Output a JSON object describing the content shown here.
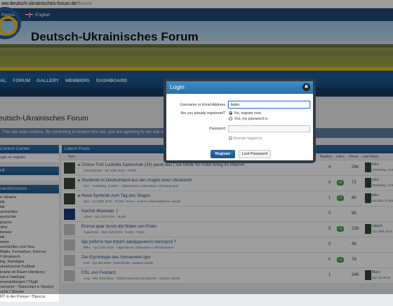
{
  "browser": {
    "url_host": "ww.deutsch-ukrainisches-forum.de",
    "url_path": "/forum/"
  },
  "topbar": {
    "register": "Register",
    "language": "English"
  },
  "site": {
    "title": "Deutsch-Ukrainisches Forum"
  },
  "nav": [
    "AL",
    "FORUM",
    "GALLERY",
    "MEMBERS",
    "DASHBOARD"
  ],
  "page": {
    "title": "eutsch-Ukrainisches Forum",
    "cookie_notice": "This site uses cookies. By continuing to browse this site, you are agreeing to our use of coo"
  },
  "sidebar": {
    "control_center": {
      "title": "Control Center",
      "body": "ogin or register"
    },
    "poll": {
      "title": "oll"
    },
    "board_structure": {
      "title": "oardstructure",
      "items": [
        "e Ukraine",
        "itik",
        "itik",
        "achrichten",
        "eschichte",
        "prache",
        "ultur",
        "iteratur",
        "itik",
        "eisen",
        "eschichtes und Visa",
        "Radio, Fernsehen, Internet",
        "f Ukrainisch",
        "log, Sonstiges",
        "ukrainischer Fußball",
        "kraine im Raum Hamburg /",
        "naї в Гамбурзі",
        "eranstaltungen / Події",
        "ransport - Транспорт в Україну",
        "uche / Шукаю",
        "RT in der Presse / Пресса"
      ]
    }
  },
  "posts": {
    "title": "Latest Posts",
    "columns": {
      "topic": "Topic",
      "replies": "Replies",
      "likes": "Likes",
      "views": "Views",
      "last_reply": "Last Reply"
    },
    "rows": [
      {
        "title": "Online-Troll Ludmilla Sawtschuk (34) packt aus | Sie führte für Putin Krieg im Internet",
        "meta": "ChristophHE · Apr 15th 2015 · Politik",
        "replies": "4",
        "likes": "",
        "views": "294",
        "last_user": "icke",
        "last_time": "Yesterday, 3:48pm",
        "avatar": "dark",
        "unread": true
      },
      {
        "title": "Studieren in Deutschland aus den Augen einer Ukrainerin",
        "meta": "icke · Yesterday, 3:48pm · Allgemeines, Diskussion / Обговорення",
        "replies": "0",
        "likes": "+2",
        "views": "72",
        "last_user": "icke",
        "last_time": "Yesterday, 3:48pm",
        "avatar": "dark",
        "unread": true
      },
      {
        "title": "Neue Symbole zum Tag des Sieges",
        "meta": "icke · Apr 25th 2015 · Politik / News - andere osteuropäische Länder",
        "replies": "1",
        "likes": "+1",
        "views": "80",
        "last_user": "icke",
        "last_time": "Monday, 8:43pm",
        "avatar": "dark",
        "unread": true
      },
      {
        "title": "Nachte Монеакр :)",
        "meta": "robert · Apr 21st 2015 · Musik",
        "replies": "0",
        "likes": "",
        "views": "66",
        "last_user": "",
        "last_time": "",
        "avatar": "gb",
        "unread": false
      },
      {
        "title": "Einmal quer durch die Noten von Polen",
        "meta": "Aquacenio · Mar 21st 2015 · Kultur - Polen",
        "replies": "5",
        "likes": "+5",
        "views": "228",
        "last_user": "robert",
        "last_time": "Apr 20th 2015",
        "avatar": "blank",
        "unread": false
      },
      {
        "title": "Що робити при втраті закордонного паспорта ?",
        "meta": "Rilke · Apr 15th 2015 · Allgemeines, Diskussion / Обговорення",
        "replies": "0",
        "likes": "",
        "views": "49",
        "last_user": "",
        "last_time": "",
        "avatar": "blank",
        "unread": false
      },
      {
        "title": "Die Etymologie des Vornamens Igor",
        "meta": "Ivek · Apr 3rd 2015 · Geschichte - andere Länder",
        "replies": "0",
        "likes": "+1",
        "views": "79",
        "last_user": "",
        "last_time": "",
        "avatar": "blank",
        "unread": false
      },
      {
        "title": "DSL und Festnetz",
        "meta": "Amy · Mar 31st 2015 · Telefon/Internet und Internet - andere Länder",
        "replies": "1",
        "likes": "",
        "views": "246",
        "last_user": "Marc",
        "last_time": "Apr 1st 2015",
        "avatar": "blank",
        "unread": false
      }
    ]
  },
  "login_dialog": {
    "title": "Login",
    "close_glyph": "✖",
    "username_label": "Username or Email Address",
    "username_value": "bobo",
    "registered_label": "Are you already registered?",
    "option_no": "No, register now.",
    "option_yes": "Yes, my password is:",
    "password_label": "Password",
    "remember_label": "Remain logged in",
    "register_button": "Register",
    "lost_password_button": "Lost Password"
  }
}
